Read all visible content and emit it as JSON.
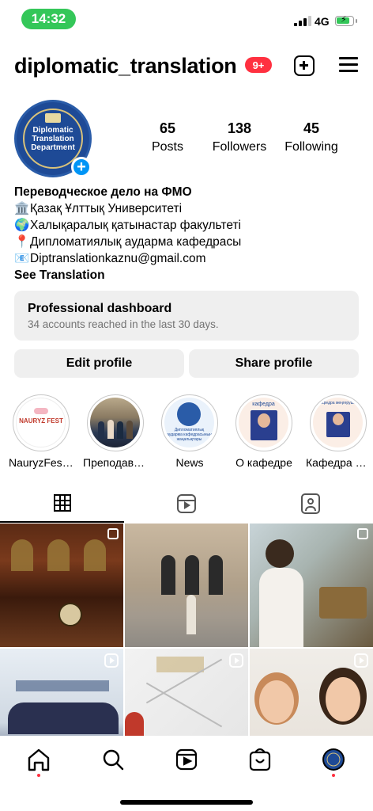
{
  "status": {
    "time": "14:32",
    "network": "4G"
  },
  "header": {
    "username": "diplomatic_translation",
    "notification_badge": "9+"
  },
  "avatar": {
    "line1": "Diplomatic",
    "line2": "Translation",
    "line3": "Department"
  },
  "stats": [
    {
      "value": "65",
      "label": "Posts"
    },
    {
      "value": "138",
      "label": "Followers"
    },
    {
      "value": "45",
      "label": "Following"
    }
  ],
  "bio": {
    "name": "Переводческое дело на ФМО",
    "lines": [
      {
        "emoji": "🏛️",
        "text": "Қазақ Ұлттық Университеті"
      },
      {
        "emoji": "🌍",
        "text": "Халықаралық қатынастар факультеті"
      },
      {
        "emoji": "📍",
        "text": "Дипломатиялық аударма кафедрасы"
      },
      {
        "emoji": "📧",
        "text": "Diptranslationkaznu@gmail.com"
      }
    ],
    "see_translation": "See Translation"
  },
  "dashboard": {
    "title": "Professional dashboard",
    "subtitle": "34 accounts reached in the last 30 days."
  },
  "buttons": {
    "edit": "Edit profile",
    "share": "Share profile"
  },
  "highlights": [
    {
      "label": "NauryzFest...",
      "cover": "NAURYZ FEST"
    },
    {
      "label": "Преподава..."
    },
    {
      "label": "News",
      "cover": "Дипломатиялық аударма кафедрасының жаңалықтары"
    },
    {
      "label": "О кафедре",
      "cover": "кафедра"
    },
    {
      "label": "Кафедра ту...",
      "cover": "Кафедра меңгерушісі"
    }
  ],
  "colors": {
    "accent": "#0095f6",
    "badge": "#ff3040",
    "status_green": "#34c759",
    "button_bg": "#efefef"
  }
}
